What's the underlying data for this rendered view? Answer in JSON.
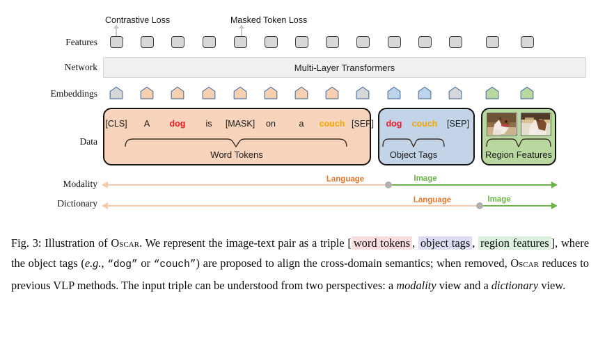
{
  "figure": {
    "row_labels": {
      "features": "Features",
      "network": "Network",
      "embeddings": "Embeddings",
      "data": "Data",
      "modality": "Modality",
      "dictionary": "Dictionary"
    },
    "losses": [
      {
        "label": "Contrastive Loss",
        "target_index": 0
      },
      {
        "label": "Masked Token Loss",
        "target_index": 4
      }
    ],
    "network_label": "Multi-Layer Transformers",
    "feature_count": 14,
    "embeddings": [
      {
        "color": "#d5d7d9"
      },
      {
        "color": "#f7d0b0"
      },
      {
        "color": "#f7d0b0"
      },
      {
        "color": "#f7d0b0"
      },
      {
        "color": "#f7d0b0"
      },
      {
        "color": "#f7d0b0"
      },
      {
        "color": "#f7d0b0"
      },
      {
        "color": "#f7d0b0"
      },
      {
        "color": "#d5d7d9"
      },
      {
        "color": "#bcd4ec"
      },
      {
        "color": "#bcd4ec"
      },
      {
        "color": "#d5d7d9"
      },
      {
        "color": "#b9d8a0"
      },
      {
        "color": "#b9d8a0"
      }
    ],
    "word_tokens_box": {
      "group_label": "Word Tokens",
      "tokens": [
        {
          "text": "[CLS]",
          "color": "#161616",
          "bold": false
        },
        {
          "text": "A",
          "color": "#161616",
          "bold": false
        },
        {
          "text": "dog",
          "color": "#ec1c24",
          "bold": true
        },
        {
          "text": "is",
          "color": "#161616",
          "bold": false
        },
        {
          "text": "[MASK]",
          "color": "#161616",
          "bold": false
        },
        {
          "text": "on",
          "color": "#161616",
          "bold": false
        },
        {
          "text": "a",
          "color": "#161616",
          "bold": false
        },
        {
          "text": "couch",
          "color": "#f5a800",
          "bold": true
        },
        {
          "text": "[SEP]",
          "color": "#161616",
          "bold": false
        }
      ]
    },
    "object_tags_box": {
      "group_label": "Object Tags",
      "tokens": [
        {
          "text": "dog",
          "color": "#ec1c24",
          "bold": true
        },
        {
          "text": "couch",
          "color": "#f5a800",
          "bold": true
        },
        {
          "text": "[SEP]",
          "color": "#161616",
          "bold": false
        }
      ]
    },
    "region_features_box": {
      "group_label": "Region Features",
      "thumbnails": [
        {
          "alt": "dog-on-couch-crop-1"
        },
        {
          "alt": "dog-on-couch-crop-2"
        }
      ]
    },
    "axes": [
      {
        "name": "Modality",
        "segments": [
          {
            "label": "Language",
            "color": "#e8762c"
          },
          {
            "label": "Image",
            "color": "#6cb44a"
          }
        ]
      },
      {
        "name": "Dictionary",
        "segments": [
          {
            "label": "Language",
            "color": "#e8762c"
          },
          {
            "label": "Image",
            "color": "#6cb44a"
          }
        ]
      }
    ],
    "colors": {
      "language": "#e8762c",
      "image": "#6cb44a",
      "word_box": "#f7d4bb",
      "tag_box": "#c3d3e8",
      "region_box": "#b9d8a0",
      "feature_box": "#d8d8d8",
      "network_bar": "#f0f0f0"
    }
  },
  "caption": {
    "label": "Fig. 3:",
    "p1": "Illustration of",
    "name": "Oscar",
    "p2": ". We represent the image-text pair as a triple [",
    "hl_word": "word tokens",
    "sep1": ",",
    "hl_obj": "object tags",
    "sep2": ",",
    "hl_reg": "region features",
    "p3": "], where the object tags (",
    "eg": "e.g.,",
    "q_dog": "“dog”",
    "p4": "or",
    "q_couch": "“couch”",
    "p5": ") are proposed to align the cross-domain semantics; when removed,",
    "name2": "Oscar",
    "p6": "reduces to previous VLP methods. The input triple can be understood from two perspectives: a",
    "it_mod": "modality",
    "p7": "view and a",
    "it_dict": "dictionary",
    "p8": "view."
  }
}
